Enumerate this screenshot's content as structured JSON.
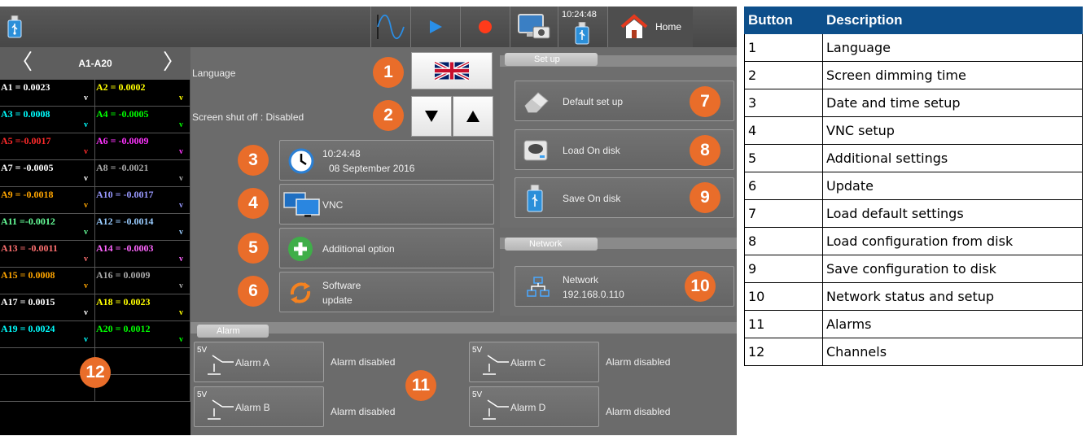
{
  "topbar": {
    "clock": "10:24:48",
    "home_label": "Home"
  },
  "channels": {
    "range_label": "A1-A20",
    "items": [
      {
        "label": "A1 = 0.0023",
        "unit": "v",
        "color": "#ffffff"
      },
      {
        "label": "A2 = 0.0002",
        "unit": "v",
        "color": "#ffff00"
      },
      {
        "label": "A3 = 0.0008",
        "unit": "v",
        "color": "#00ffff"
      },
      {
        "label": "A4 = -0.0005",
        "unit": "v",
        "color": "#00ff00"
      },
      {
        "label": "A5 =-0.0017",
        "unit": "v",
        "color": "#ff2a2a"
      },
      {
        "label": "A6 = -0.0009",
        "unit": "v",
        "color": "#ff33ff"
      },
      {
        "label": "A7 = -0.0005",
        "unit": "v",
        "color": "#ffffff"
      },
      {
        "label": "A8 = -0.0021",
        "unit": "v",
        "color": "#a8a8a8"
      },
      {
        "label": "A9 = -0.0018",
        "unit": "v",
        "color": "#ffa500"
      },
      {
        "label": "A10 = -0.0017",
        "unit": "v",
        "color": "#9999ff"
      },
      {
        "label": "A11 =-0.0012",
        "unit": "v",
        "color": "#66ff99"
      },
      {
        "label": "A12 = -0.0014",
        "unit": "v",
        "color": "#99ccff"
      },
      {
        "label": "A13 = -0.0011",
        "unit": "v",
        "color": "#ff7070"
      },
      {
        "label": "A14 = -0.0003",
        "unit": "v",
        "color": "#ff66ff"
      },
      {
        "label": "A15 = 0.0008",
        "unit": "v",
        "color": "#ffa500"
      },
      {
        "label": "A16 = 0.0009",
        "unit": "v",
        "color": "#a8a8a8"
      },
      {
        "label": "A17 = 0.0015",
        "unit": "v",
        "color": "#ffffff"
      },
      {
        "label": "A18 = 0.0023",
        "unit": "v",
        "color": "#ffff00"
      },
      {
        "label": "A19 = 0.0024",
        "unit": "v",
        "color": "#00ffff"
      },
      {
        "label": "A20 = 0.0012",
        "unit": "v",
        "color": "#00ff00"
      }
    ]
  },
  "settings": {
    "language_label": "Language",
    "screen_shutoff_label": "Screen shut off : Disabled",
    "datetime_time": "10:24:48",
    "datetime_date": "08 September 2016",
    "vnc_label": "VNC",
    "additional_label": "Additional option",
    "software_update_line1": "Software",
    "software_update_line2": "update"
  },
  "setup": {
    "section_label": "Set up",
    "default_setup": "Default set up",
    "load_on_disk": "Load On disk",
    "save_on_disk": "Save On disk"
  },
  "network": {
    "section_label": "Network",
    "button_line1": "Network",
    "button_line2": "192.168.0.110"
  },
  "alarm": {
    "section_label": "Alarm",
    "voltage_label": "5V",
    "items": [
      {
        "name": "Alarm A",
        "state": "Alarm disabled"
      },
      {
        "name": "Alarm B",
        "state": "Alarm disabled"
      },
      {
        "name": "Alarm C",
        "state": "Alarm disabled"
      },
      {
        "name": "Alarm D",
        "state": "Alarm disabled"
      }
    ]
  },
  "badges": [
    "1",
    "2",
    "3",
    "4",
    "5",
    "6",
    "7",
    "8",
    "9",
    "10",
    "11",
    "12"
  ],
  "legend": {
    "headers": [
      "Button",
      "Description"
    ],
    "rows": [
      [
        "1",
        "Language"
      ],
      [
        "2",
        "Screen dimming time"
      ],
      [
        "3",
        "Date and time setup"
      ],
      [
        "4",
        "VNC setup"
      ],
      [
        "5",
        "Additional settings"
      ],
      [
        "6",
        "Update"
      ],
      [
        "7",
        "Load default settings"
      ],
      [
        "8",
        "Load configuration from disk"
      ],
      [
        "9",
        "Save configuration to disk"
      ],
      [
        "10",
        "Network status and setup"
      ],
      [
        "11",
        "Alarms"
      ],
      [
        "12",
        "Channels"
      ]
    ]
  },
  "colors": {
    "badge": "#e96d2a",
    "legend_header": "#0d4f8b",
    "record_dot": "#ff3b1a",
    "play_arrow": "#2a8fe8"
  }
}
